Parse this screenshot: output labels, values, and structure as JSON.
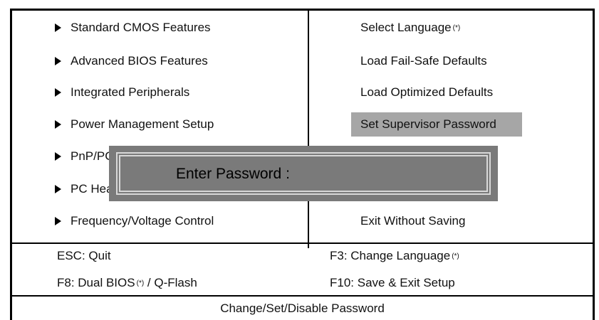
{
  "left_menu": [
    {
      "label": "Standard CMOS Features"
    },
    {
      "label": "Advanced BIOS Features"
    },
    {
      "label": "Integrated Peripherals"
    },
    {
      "label": "Power Management Setup"
    },
    {
      "label": "PnP/PCI"
    },
    {
      "label": "PC Heal"
    },
    {
      "label": "Frequency/Voltage Control"
    }
  ],
  "right_menu": [
    {
      "label": "Select Language",
      "sup": "(*)"
    },
    {
      "label": "Load Fail-Safe Defaults"
    },
    {
      "label": "Load Optimized Defaults"
    },
    {
      "label": "Set Supervisor Password",
      "selected": true
    },
    {
      "label": "Exit Without Saving"
    }
  ],
  "footer": {
    "esc": "ESC: Quit",
    "f3_prefix": "F3: Change Language",
    "f3_sup": "(*)",
    "f8_prefix": "F8: Dual BIOS",
    "f8_sup": "(*)",
    "f8_suffix": " / Q-Flash",
    "f10": "F10: Save & Exit Setup",
    "status": "Change/Set/Disable Password"
  },
  "dialog": {
    "label": "Enter Password :"
  },
  "colors": {
    "highlight": "#a6a6a6",
    "dialog_bg": "#7a7a7a",
    "dialog_border": "#d8d8d8"
  }
}
